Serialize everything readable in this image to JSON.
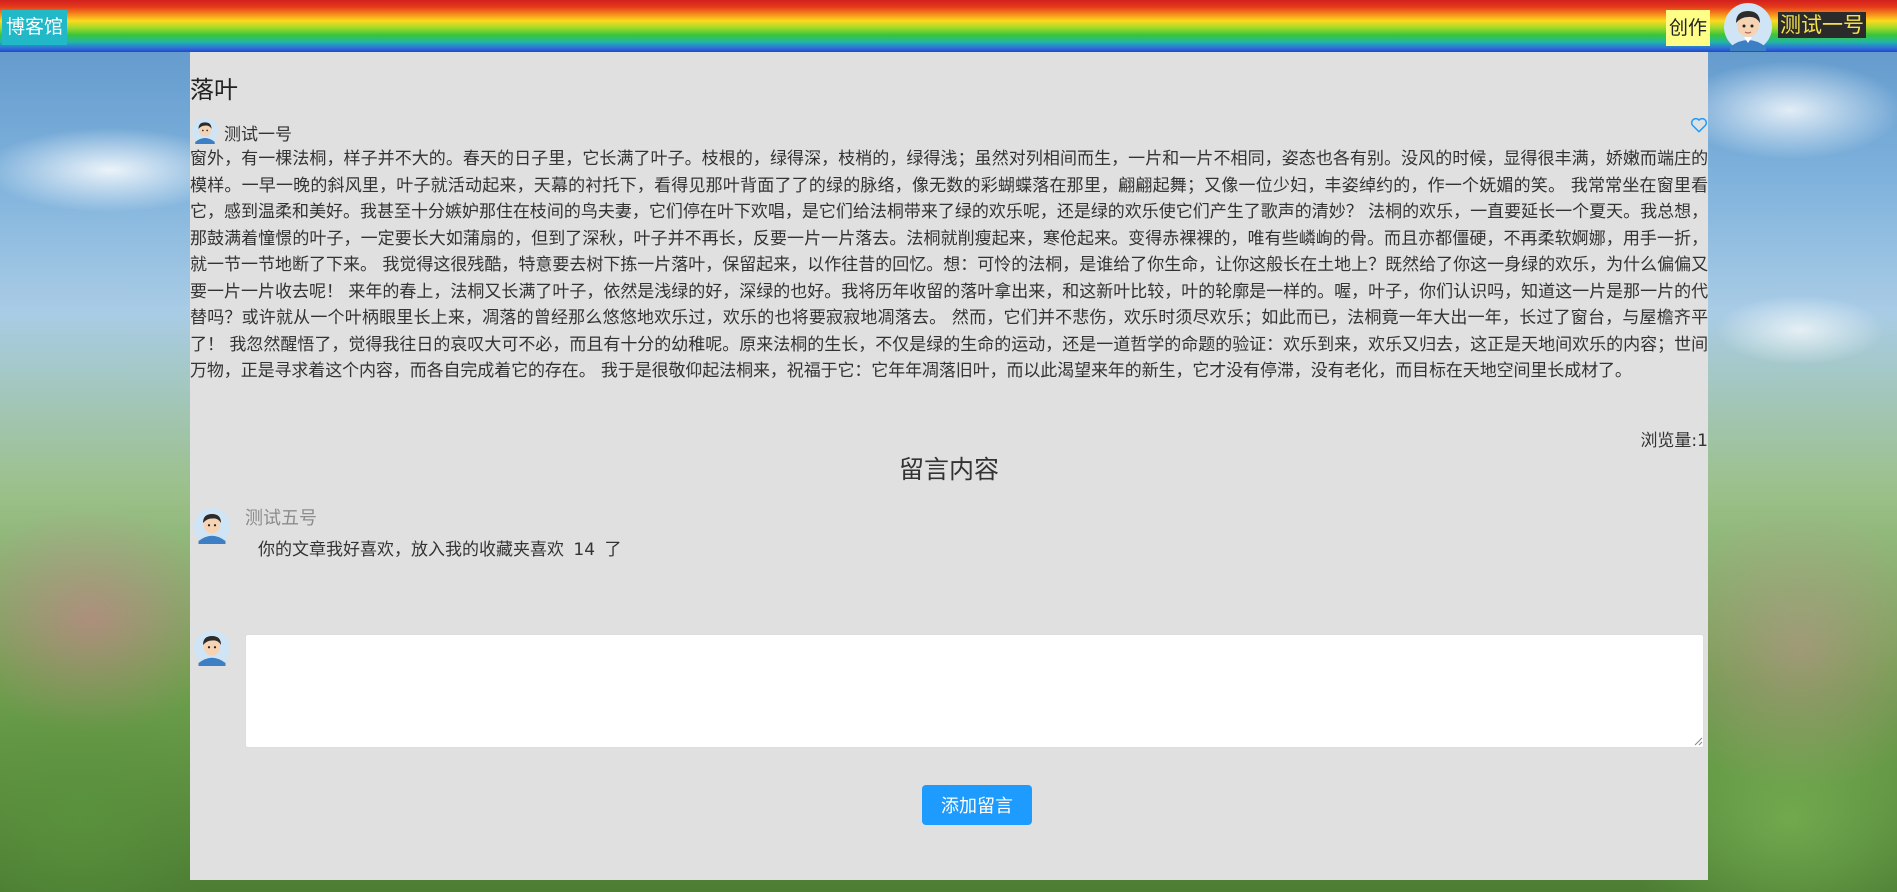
{
  "header": {
    "brand": "博客馆",
    "create_label": "创作",
    "username": "测试一号",
    "avatar_icon": "user-avatar-icon"
  },
  "article": {
    "title": "落叶",
    "author": "测试一号",
    "like_icon": "heart-icon",
    "body": "窗外，有一棵法桐，样子并不大的。春天的日子里，它长满了叶子。枝根的，绿得深，枝梢的，绿得浅；虽然对列相间而生，一片和一片不相同，姿态也各有别。没风的时候，显得很丰满，娇嫩而端庄的模样。一早一晚的斜风里，叶子就活动起来，天幕的衬托下，看得见那叶背面了了的绿的脉络，像无数的彩蝴蝶落在那里，翩翩起舞；又像一位少妇，丰姿绰约的，作一个妩媚的笑。 我常常坐在窗里看它，感到温柔和美好。我甚至十分嫉妒那住在枝间的鸟夫妻，它们停在叶下欢唱，是它们给法桐带来了绿的欢乐呢，还是绿的欢乐使它们产生了歌声的清妙？ 法桐的欢乐，一直要延长一个夏天。我总想，那鼓满着憧憬的叶子，一定要长大如蒲扇的，但到了深秋，叶子并不再长，反要一片一片落去。法桐就削瘦起来，寒伧起来。变得赤裸裸的，唯有些嶙峋的骨。而且亦都僵硬，不再柔软婀娜，用手一折，就一节一节地断了下来。 我觉得这很残酷，特意要去树下拣一片落叶，保留起来，以作往昔的回忆。想：可怜的法桐，是谁给了你生命，让你这般长在土地上？既然给了你这一身绿的欢乐，为什么偏偏又要一片一片收去呢！ 来年的春上，法桐又长满了叶子，依然是浅绿的好，深绿的也好。我将历年收留的落叶拿出来，和这新叶比较，叶的轮廓是一样的。喔，叶子，你们认识吗，知道这一片是那一片的代替吗？或许就从一个叶柄眼里长上来，凋落的曾经那么悠悠地欢乐过，欢乐的也将要寂寂地凋落去。 然而，它们并不悲伤，欢乐时须尽欢乐；如此而已，法桐竟一年大出一年，长过了窗台，与屋檐齐平了！ 我忽然醒悟了，觉得我往日的哀叹大可不必，而且有十分的幼稚呢。原来法桐的生长，不仅是绿的生命的运动，还是一道哲学的命题的验证：欢乐到来，欢乐又归去，这正是天地间欢乐的内容；世间万物，正是寻求着这个内容，而各自完成着它的存在。 我于是很敬仰起法桐来，祝福于它：它年年凋落旧叶，而以此渴望来年的新生，它才没有停滞，没有老化，而目标在天地空间里长成材了。",
    "views_label": "浏览量:",
    "views": "1"
  },
  "comments": {
    "heading": "留言内容",
    "items": [
      {
        "user": "测试五号",
        "text": "你的文章我好喜欢，放入我的收藏夹喜欢 14 了"
      }
    ],
    "reply_placeholder": "",
    "submit_label": "添加留言"
  },
  "colors": {
    "brand_bg": "#21b8c8",
    "create_bg": "#ffff88",
    "panel_bg": "#e0e0e0",
    "button_bg": "#1e9bff",
    "username_fg": "#f5e24a"
  }
}
